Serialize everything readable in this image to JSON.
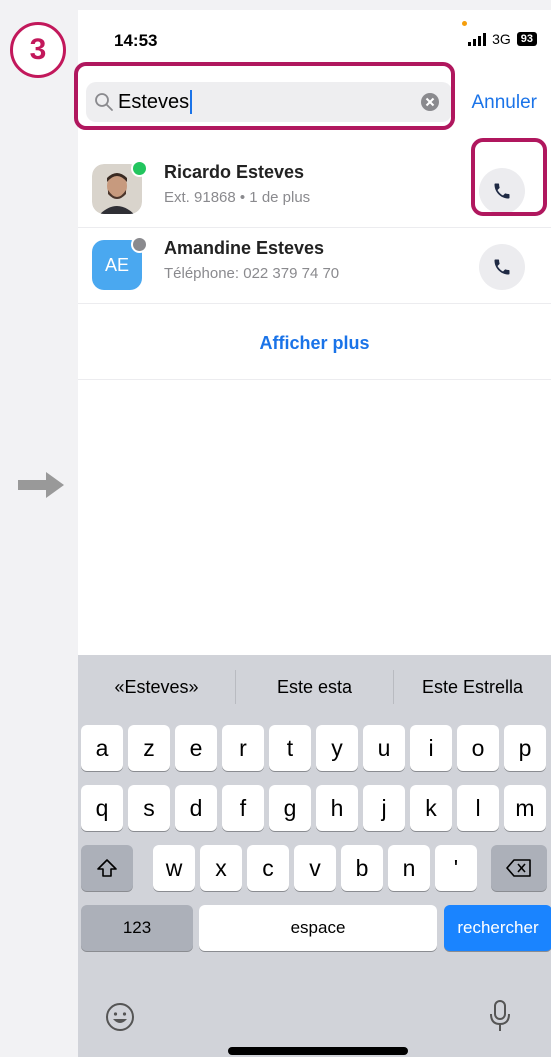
{
  "overlay": {
    "step_number": "3",
    "highlight_color": "#b0175e"
  },
  "status_bar": {
    "time": "14:53",
    "network": "3G",
    "battery": "93"
  },
  "search": {
    "value": "Esteves",
    "cancel_label": "Annuler"
  },
  "contacts": [
    {
      "name": "Ricardo Esteves",
      "detail": "Ext. 91868 • 1 de plus",
      "presence_color": "#22c55e",
      "avatar": "photo"
    },
    {
      "name": "Amandine Esteves",
      "detail": "Téléphone: 022 379 74 70",
      "initials": "AE",
      "presence_color": "#8a8a8e",
      "avatar": "initials"
    }
  ],
  "show_more_label": "Afficher plus",
  "keyboard": {
    "suggestions": [
      "«Esteves»",
      "Este esta",
      "Este Estrella"
    ],
    "row1": [
      "a",
      "z",
      "e",
      "r",
      "t",
      "y",
      "u",
      "i",
      "o",
      "p"
    ],
    "row2": [
      "q",
      "s",
      "d",
      "f",
      "g",
      "h",
      "j",
      "k",
      "l",
      "m"
    ],
    "row3": [
      "w",
      "x",
      "c",
      "v",
      "b",
      "n",
      "'"
    ],
    "numbers_label": "123",
    "space_label": "espace",
    "search_label": "rechercher"
  },
  "icons": {
    "shift": "shift-icon",
    "backspace": "backspace-icon",
    "emoji": "emoji-icon",
    "mic": "mic-icon",
    "phone": "phone-icon",
    "search": "search-icon",
    "clear": "clear-icon"
  },
  "colors": {
    "accent": "#1a73e8",
    "key_blue": "#1a84ff"
  }
}
